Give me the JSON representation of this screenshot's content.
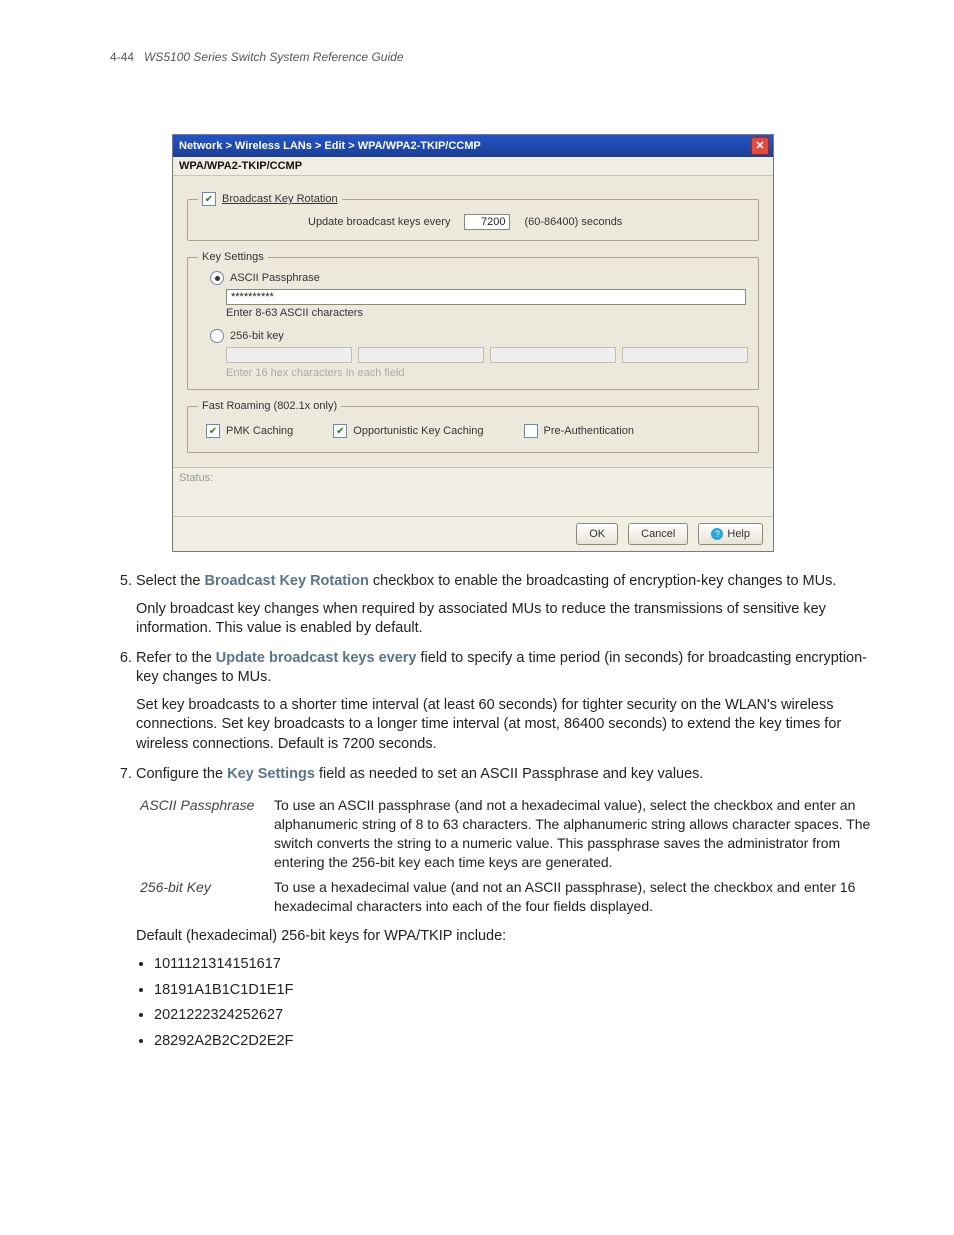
{
  "page_header": {
    "number": "4-44",
    "title": "WS5100 Series Switch System Reference Guide"
  },
  "dialog": {
    "breadcrumb": "Network > Wireless LANs > Edit > WPA/WPA2-TKIP/CCMP",
    "subtitle": "WPA/WPA2-TKIP/CCMP",
    "broadcast": {
      "legend": "Broadcast Key Rotation",
      "update_label": "Update broadcast keys every",
      "value": "7200",
      "range": "(60-86400) seconds"
    },
    "keysettings": {
      "legend": "Key Settings",
      "ascii_label": "ASCII Passphrase",
      "ascii_value": "**********",
      "ascii_hint": "Enter 8-63 ASCII characters",
      "bit_label": "256-bit key",
      "bit_hint": "Enter 16 hex characters in each field"
    },
    "fastroam": {
      "legend": "Fast Roaming (802.1x only)",
      "pmk": "PMK Caching",
      "opp": "Opportunistic Key Caching",
      "pre": "Pre-Authentication"
    },
    "status_label": "Status:",
    "buttons": {
      "ok": "OK",
      "cancel": "Cancel",
      "help": "Help"
    }
  },
  "doc": {
    "li5a": "Select the ",
    "li5_bold": "Broadcast Key Rotation",
    "li5b": " checkbox to enable the broadcasting of encryption-key changes to MUs.",
    "li5p": "Only broadcast key changes when required by associated MUs to reduce the transmissions of sensitive key information. This value is enabled by default.",
    "li6a": "Refer to the ",
    "li6_bold": "Update broadcast keys every",
    "li6b": " field to specify a time period (in seconds) for broadcasting encryption-key changes to MUs.",
    "li6p": "Set key broadcasts to a shorter time interval (at least 60 seconds) for tighter security on the WLAN's wireless connections. Set key broadcasts to a longer time interval (at most, 86400 seconds) to extend the key times for wireless connections. Default is 7200 seconds.",
    "li7a": "Configure the ",
    "li7_bold": "Key Settings",
    "li7b": " field as needed to set an ASCII Passphrase and key values.",
    "desc": {
      "ascii_term": "ASCII Passphrase",
      "ascii_desc": "To use an ASCII passphrase (and not a hexadecimal value), select the checkbox and enter an alphanumeric string of 8 to 63 characters. The alphanumeric string allows character spaces. The switch converts the string to a numeric value. This passphrase saves the administrator from entering the 256-bit key each time keys are generated.",
      "bit_term": "256-bit Key",
      "bit_desc": "To use a hexadecimal value (and not an ASCII passphrase), select the checkbox and enter 16 hexadecimal characters into each of the four fields displayed."
    },
    "defaults_intro": "Default (hexadecimal) 256-bit keys for WPA/TKIP include:",
    "keys": [
      "1011121314151617",
      "18191A1B1C1D1E1F",
      "2021222324252627",
      "28292A2B2C2D2E2F"
    ]
  }
}
